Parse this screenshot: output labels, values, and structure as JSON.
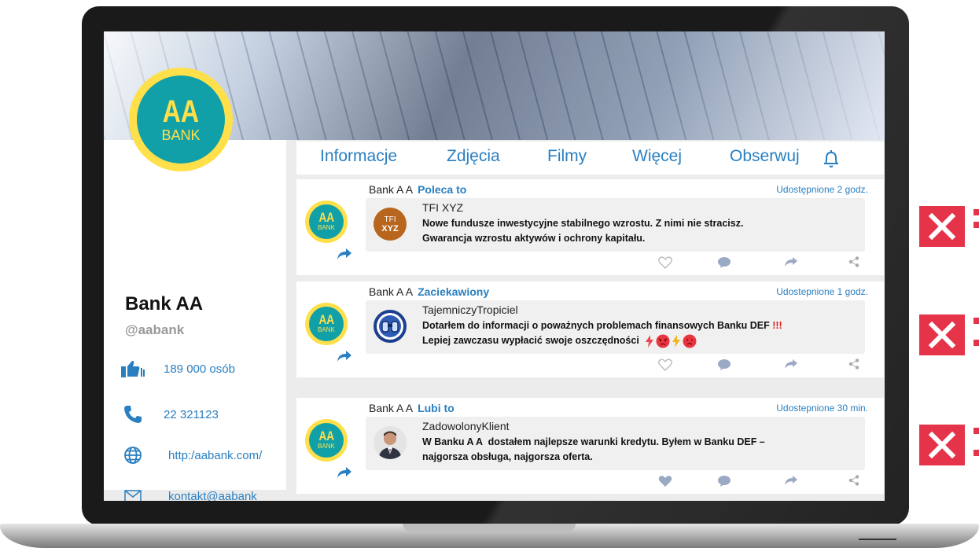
{
  "profile": {
    "logo_top": "AA",
    "logo_bottom": "BANK",
    "name": "Bank AA",
    "handle": "@aabank",
    "followers": "189 000 osób",
    "phone": "22 321123",
    "website": "http:/aabank.com/",
    "email": "kontakt@aabank",
    "icons": [
      "thumbs-up-icon",
      "phone-icon",
      "globe-icon",
      "envelope-icon"
    ]
  },
  "tabs": [
    "Informacje",
    "Zdjęcia",
    "Filmy",
    "Więcej",
    "Obserwuj"
  ],
  "posts": [
    {
      "author": "Bank A A",
      "action": "Poleca to",
      "time": "Udostępnione 2 godz.",
      "card_avatar_top": "TFI",
      "card_avatar_bottom": "XYZ",
      "card_name": "TFI XYZ",
      "card_text_1": "Nowe fundusze inwestycyjne stabilnego wzrostu. Z nimi nie stracisz.",
      "card_text_2": "Gwarancja wzrostu aktywów i ochrony kapitału.",
      "card_text_1_suffix": "",
      "liked": false
    },
    {
      "author": "Bank A A",
      "action": "Zaciekawiony",
      "time": "Udostepnione 1 godz.",
      "card_name": "TajemniczyTropiciel",
      "card_text_1": "Dotarłem do informacji o poważnych problemach finansowych Banku DEF ",
      "card_text_1_suffix": "!!!",
      "card_text_2": "Lepiej zawczasu wypłacić swoje oszczędności",
      "liked": false
    },
    {
      "author": "Bank A A",
      "action": "Lubi to",
      "time": "Udostepnione 30 min.",
      "card_name": "ZadowolonyKlient",
      "card_text_1": "W Banku A A  dostałem najlepsze warunki kredytu. Byłem w Banku DEF –",
      "card_text_1_suffix": "",
      "card_text_2": "najgorsza obsługa, najgorsza oferta.",
      "liked": true
    }
  ],
  "colors": {
    "accent": "#2a7fc0",
    "logo_yellow": "#ffe04a",
    "logo_teal": "#12a0a8",
    "alert_red": "#e5344a"
  }
}
